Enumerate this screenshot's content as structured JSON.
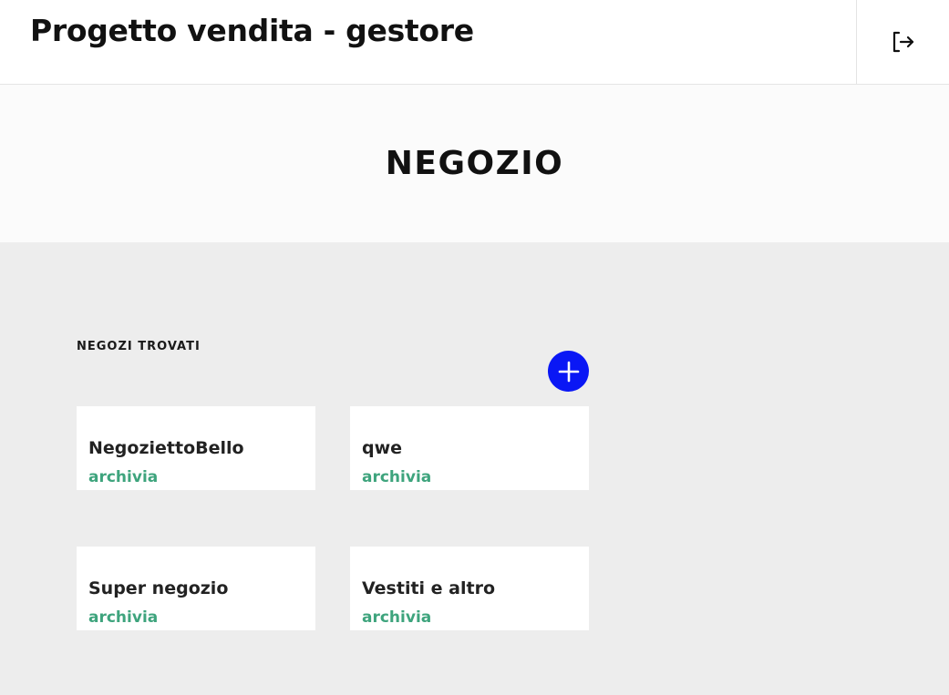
{
  "header": {
    "title": "Progetto vendita - gestore",
    "logout_icon": "logout-icon"
  },
  "hero": {
    "title": "NEGOZIO"
  },
  "shops": {
    "label": "NEGOZI TROVATI",
    "add_icon": "plus-icon",
    "colors": {
      "add_button": "#0a17f5",
      "action": "#3ea47d"
    },
    "items": [
      {
        "name": "NegoziettoBello",
        "action": "archivia"
      },
      {
        "name": "qwe",
        "action": "archivia"
      },
      {
        "name": "Super negozio",
        "action": "archivia"
      },
      {
        "name": "Vestiti e altro",
        "action": "archivia"
      }
    ]
  }
}
